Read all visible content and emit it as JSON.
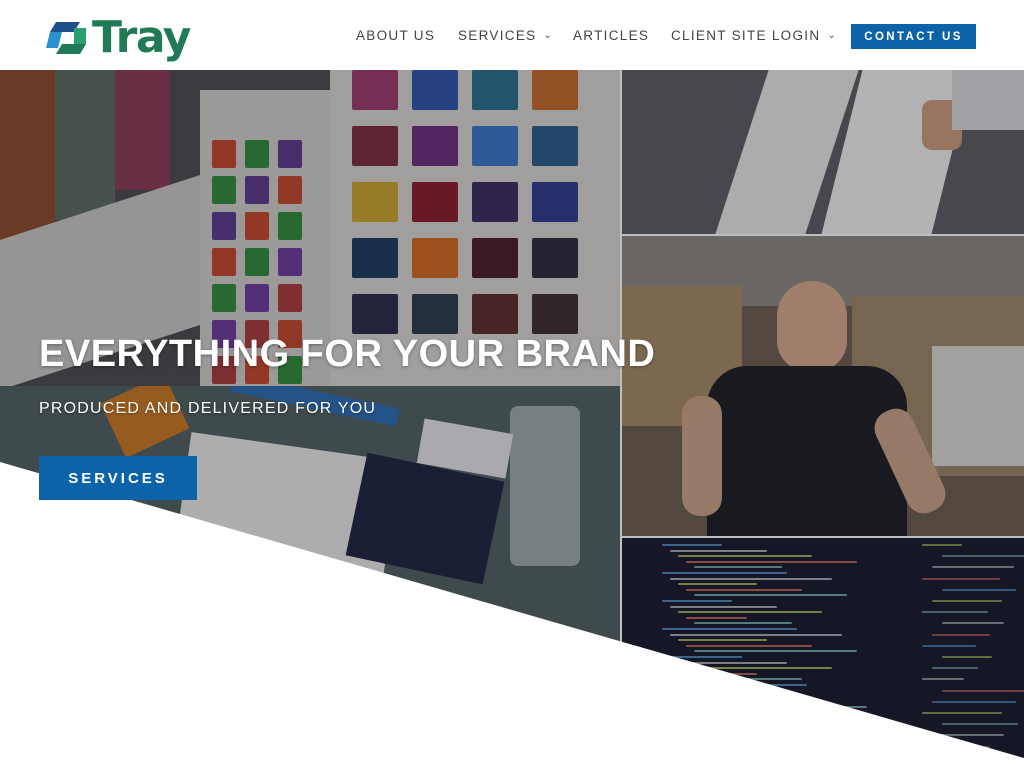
{
  "brand": {
    "name": "Tray",
    "accent": "#1f7a55",
    "primary_blue": "#0d63a8"
  },
  "nav": {
    "items": [
      {
        "label": "ABOUT US",
        "has_dropdown": false
      },
      {
        "label": "SERVICES",
        "has_dropdown": true
      },
      {
        "label": "ARTICLES",
        "has_dropdown": false
      },
      {
        "label": "CLIENT SITE LOGIN",
        "has_dropdown": true
      }
    ],
    "contact_label": "CONTACT US"
  },
  "hero": {
    "title": "EVERYTHING FOR YOUR BRAND",
    "subtitle": "PRODUCED AND DELIVERED FOR YOU",
    "button_label": "SERVICES"
  },
  "icons": {
    "logo": "tray-logo-icon",
    "dropdown": "chevron-down-icon"
  }
}
